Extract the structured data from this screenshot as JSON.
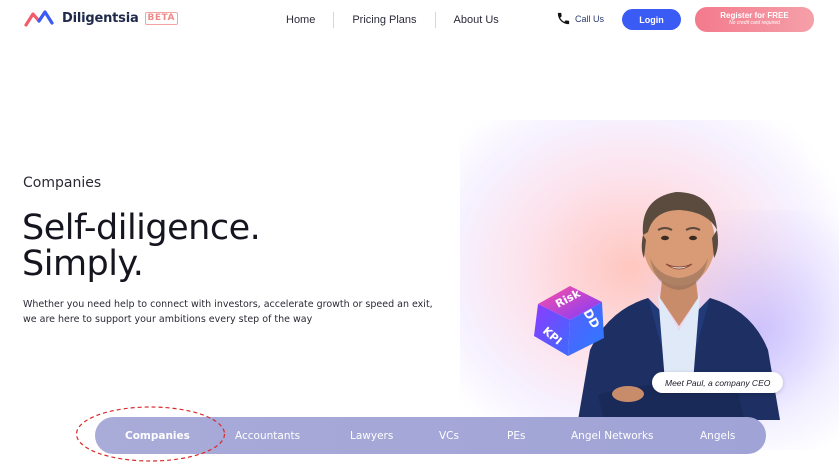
{
  "header": {
    "brand": "Diligentsia",
    "badge": "BETA",
    "nav": [
      "Home",
      "Pricing Plans",
      "About Us"
    ],
    "call_label": "Call Us",
    "login_label": "Login",
    "register_label": "Register for FREE",
    "register_sub": "No credit card required"
  },
  "hero": {
    "eyebrow": "Companies",
    "headline_line1": "Self-diligence.",
    "headline_line2": "Simply.",
    "subtext_line1": "Whether you need help to connect with investors, accelerate growth or speed an exit,",
    "subtext_line2": "we are here to support your ambitions every step of the way",
    "caption": "Meet Paul, a company CEO",
    "cube_faces": [
      "Risk",
      "DD",
      "KPI"
    ]
  },
  "segments": {
    "items": [
      "Companies",
      "Accountants",
      "Lawyers",
      "VCs",
      "PEs",
      "Angel Networks",
      "Angels"
    ],
    "active": "Companies"
  },
  "colors": {
    "brand_blue": "#3b5bf5",
    "register_pink": "#f37a8c",
    "pill_bar": "#a5a8d7",
    "annotation_red": "#d92b2b"
  }
}
